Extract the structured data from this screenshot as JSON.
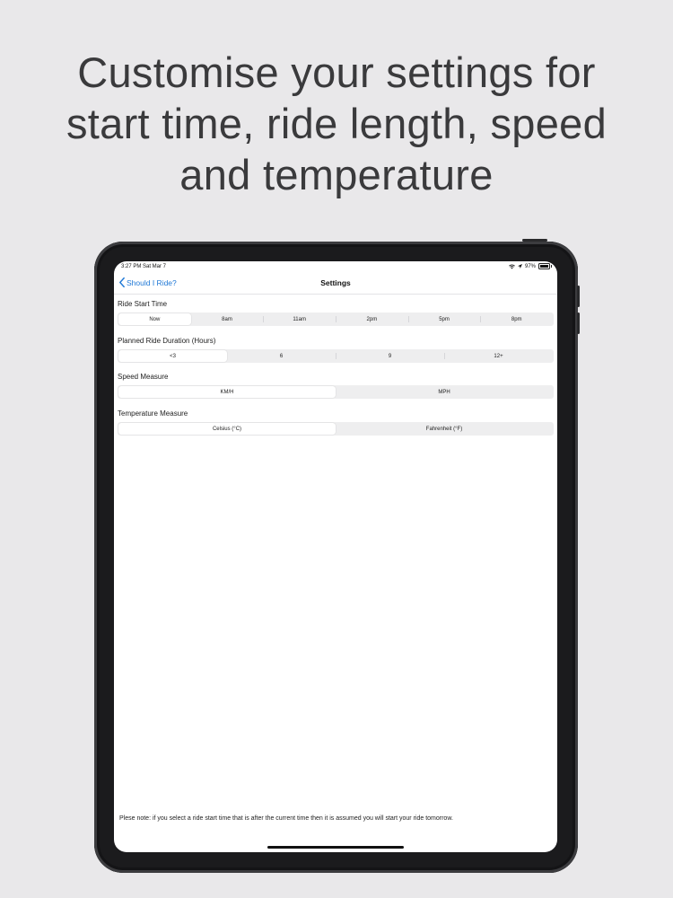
{
  "headline": {
    "line1": "Customise your settings for",
    "line2": "start time, ride length, speed",
    "line3": "and temperature"
  },
  "status_bar": {
    "time": "3:27 PM  Sat Mar 7",
    "battery": "97%",
    "battery_level": 0.97
  },
  "nav": {
    "back_label": "Should I Ride?",
    "title": "Settings"
  },
  "sections": {
    "start_time": {
      "label": "Ride Start Time",
      "options": [
        "Now",
        "8am",
        "11am",
        "2pm",
        "5pm",
        "8pm"
      ],
      "selected": 0
    },
    "duration": {
      "label": "Planned Ride Duration (Hours)",
      "options": [
        "<3",
        "6",
        "9",
        "12+"
      ],
      "selected": 0
    },
    "speed": {
      "label": "Speed Measure",
      "options": [
        "KM/H",
        "MPH"
      ],
      "selected": 0
    },
    "temperature": {
      "label": "Temperature Measure",
      "options": [
        "Celsius (°C)",
        "Fahrenheit (°F)"
      ],
      "selected": 0
    }
  },
  "note": "Plese note: if you select a ride start time that is after the current time then it is assumed you will start your ride tomorrow.",
  "colors": {
    "accent": "#1f78d6",
    "background": "#e9e8ea",
    "device": "#1b1b1d"
  }
}
